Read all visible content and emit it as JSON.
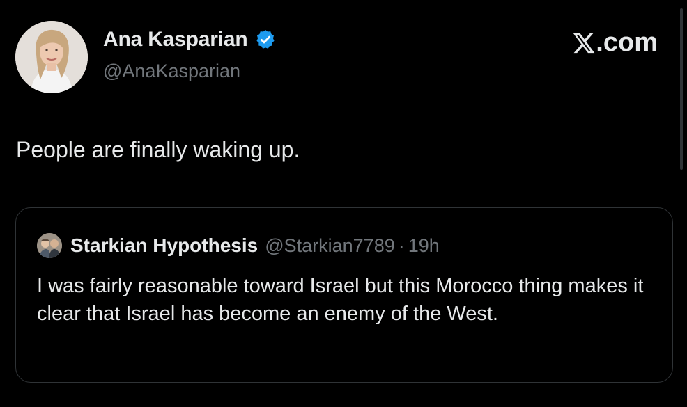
{
  "author": {
    "name": "Ana Kasparian",
    "handle": "@AnaKasparian",
    "verified": true,
    "avatar_icon": "profile-photo"
  },
  "brand": {
    "label": ".com",
    "icon": "x-logo-icon"
  },
  "post": {
    "text": "People are finally waking up."
  },
  "quoted_post": {
    "author_name": "Starkian Hypothesis",
    "handle": "@Starkian7789",
    "separator": "·",
    "time": "19h",
    "text": "I was fairly reasonable toward Israel but this Morocco thing makes it clear that Israel has become an enemy of the West."
  },
  "colors": {
    "background": "#000000",
    "primary_text": "#e7e9ea",
    "secondary_text": "#71767b",
    "verified_badge": "#1d9bf0",
    "border": "#2f3336"
  }
}
